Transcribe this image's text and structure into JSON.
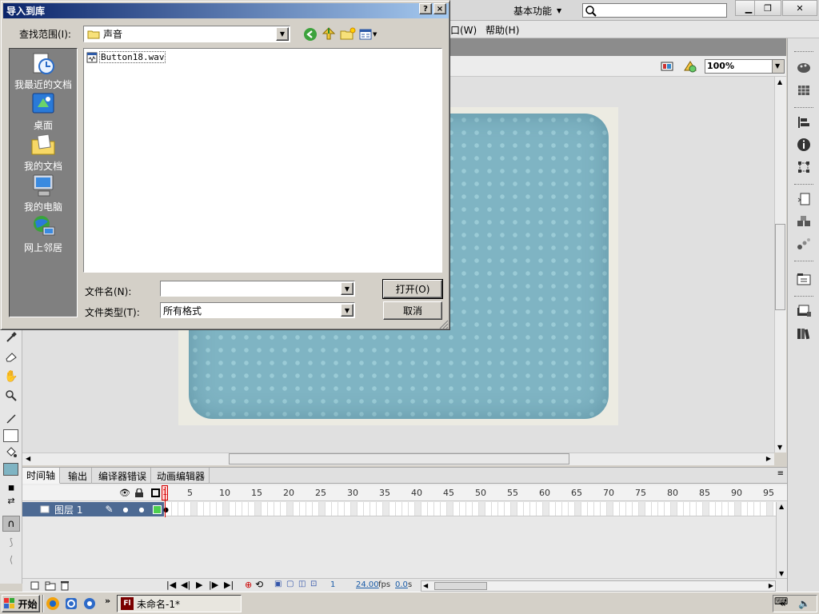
{
  "app": {
    "workspace_label": "基本功能",
    "search_placeholder": "",
    "menus": [
      {
        "label": "口(W)"
      },
      {
        "label": "帮助(H)"
      }
    ],
    "zoom": "100%"
  },
  "dialog": {
    "title": "导入到库",
    "help_btn": "?",
    "close_btn": "×",
    "look_in_label": "查找范围(I):",
    "look_in_value": "声音",
    "places": [
      {
        "label": "我最近的文档",
        "icon": "recent-documents-icon"
      },
      {
        "label": "桌面",
        "icon": "desktop-icon"
      },
      {
        "label": "我的文档",
        "icon": "my-documents-icon"
      },
      {
        "label": "我的电脑",
        "icon": "my-computer-icon"
      },
      {
        "label": "网上邻居",
        "icon": "network-places-icon"
      }
    ],
    "files": [
      {
        "name": "Button18.wav",
        "icon": "wav-file-icon"
      }
    ],
    "filename_label": "文件名(N):",
    "filename_value": "",
    "filetype_label": "文件类型(T):",
    "filetype_value": "所有格式",
    "open_btn": "打开(O)",
    "cancel_btn": "取消"
  },
  "timeline": {
    "tabs": [
      {
        "label": "时间轴"
      },
      {
        "label": "输出"
      },
      {
        "label": "编译器错误"
      },
      {
        "label": "动画编辑器"
      }
    ],
    "frame_numbers": [
      "1",
      "5",
      "10",
      "15",
      "20",
      "25",
      "30",
      "35",
      "40",
      "45",
      "50",
      "55",
      "60",
      "65",
      "70",
      "75",
      "80",
      "85",
      "90",
      "95"
    ],
    "layer_name": "图层 1",
    "current_frame": "1",
    "fps": "24.00",
    "fps_unit": "fps",
    "time": "0.0",
    "time_unit": "s"
  },
  "taskbar": {
    "start_label": "开始",
    "task_label": "未命名-1*",
    "task_icon_text": "Fl"
  },
  "colors": {
    "title_start": "#0a246a",
    "title_end": "#a6caf0",
    "stage_card": "#7fb4c3",
    "layer_row": "#4d6a93",
    "playhead": "#d40000"
  }
}
